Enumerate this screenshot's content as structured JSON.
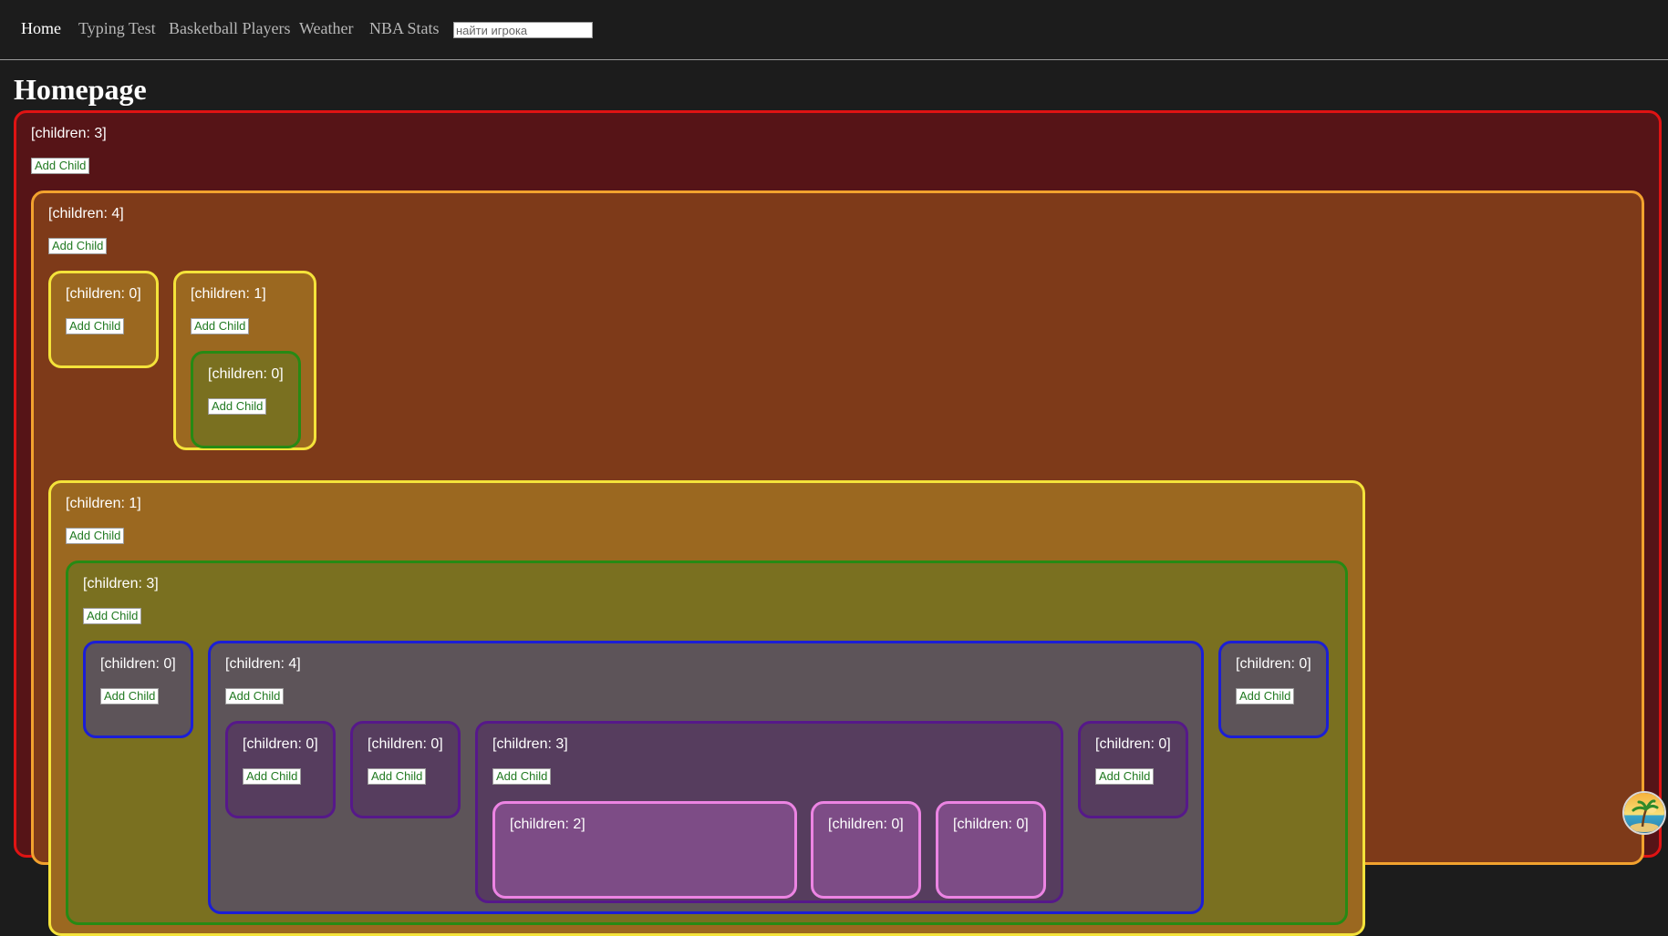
{
  "nav": {
    "links": [
      "Home",
      "Typing Test",
      "Basketball Players",
      "Weather",
      "NBA Stats"
    ],
    "search_placeholder": "найти игрока"
  },
  "page": {
    "title": "Homepage"
  },
  "tree": {
    "add_button_label": "Add Child",
    "root": "[children: 3]",
    "n1": "[children: 4]",
    "n1_a": "[children: 0]",
    "n1_b": "[children: 1]",
    "n1_b_a": "[children: 0]",
    "n1_c": "[children: 1]",
    "n1_c_a": "[children: 3]",
    "n1_c_a_1": "[children: 0]",
    "n1_c_a_2": "[children: 4]",
    "n1_c_a_2_a": "[children: 0]",
    "n1_c_a_2_b": "[children: 0]",
    "n1_c_a_2_c": "[children: 3]",
    "n1_c_a_2_c_1": "[children: 2]",
    "n1_c_a_2_c_2": "[children: 0]",
    "n1_c_a_2_c_3": "[children: 0]",
    "n1_c_a_2_d": "[children: 0]",
    "n1_c_a_3": "[children: 0]"
  },
  "colors": {
    "level0": "#561417",
    "level1": "#7e3a19",
    "level2": "#9b6820",
    "level3": "#7a7020",
    "level4": "#5d5459",
    "level5": "#563d5e",
    "level6": "#7d4c86"
  },
  "icons": {
    "avatar": "palm-tree-island-avatar"
  }
}
